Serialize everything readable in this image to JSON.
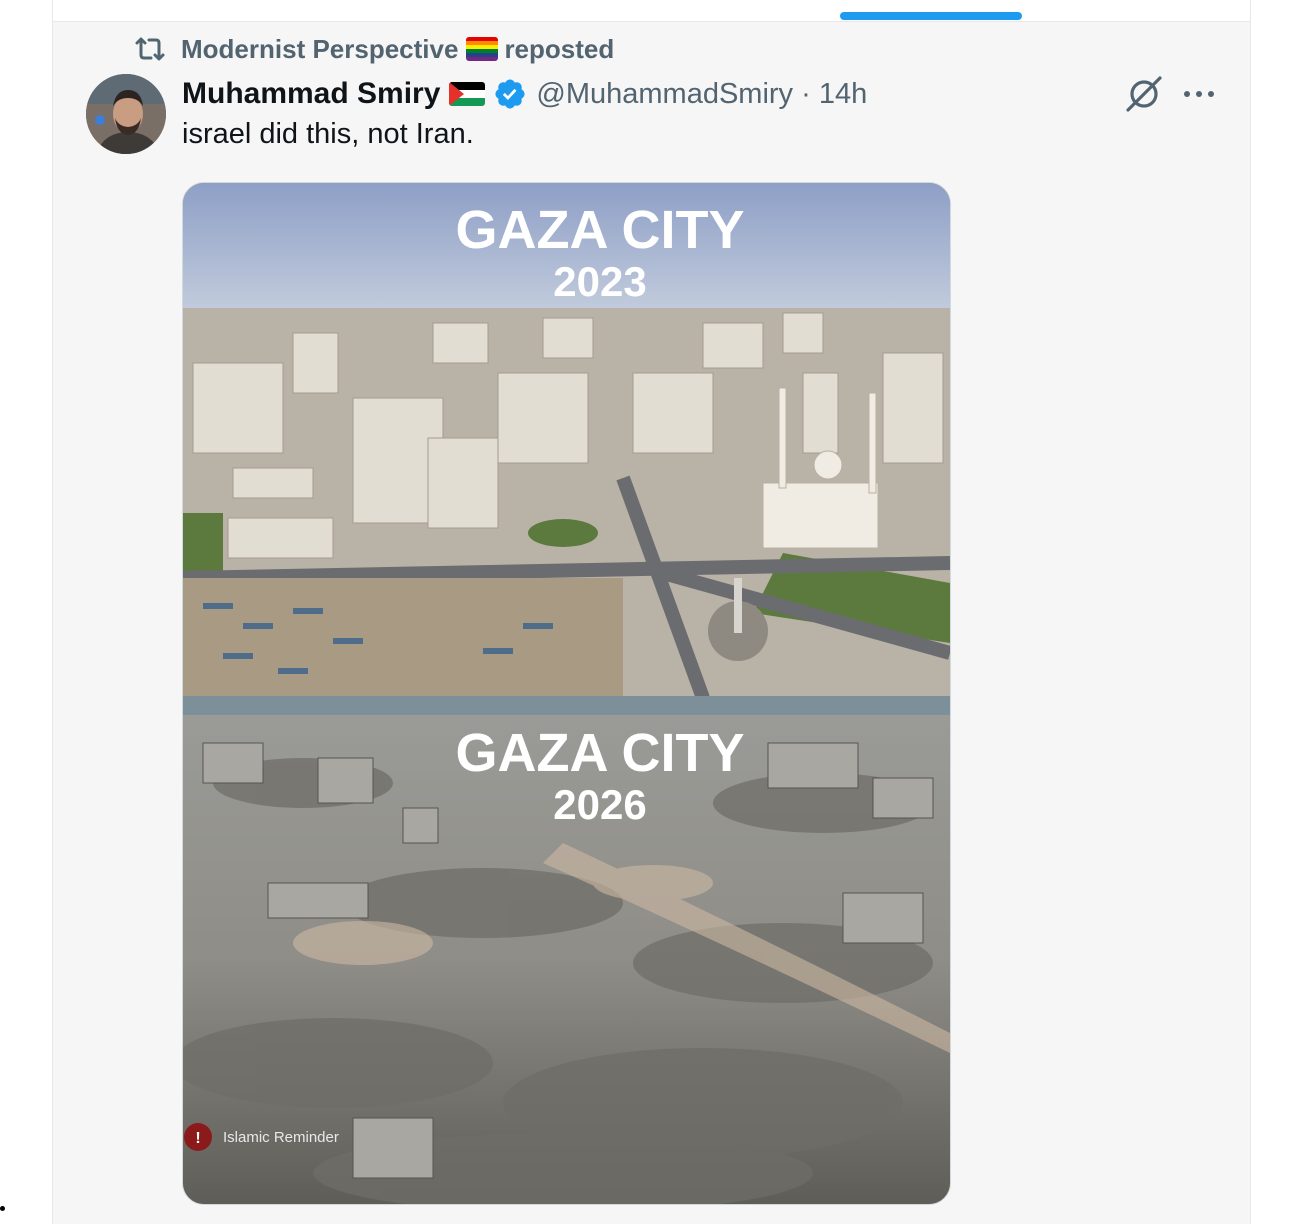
{
  "tabs": {
    "active_indicator_color": "#1d9bf0"
  },
  "repost": {
    "by": "Modernist Perspective",
    "label": "reposted",
    "icon": "repost-icon",
    "emoji": "rainbow-flag"
  },
  "tweet": {
    "author_name": "Muhammad Smiry",
    "author_flag": "palestine-flag",
    "verified": true,
    "verified_color": "#1d9bf0",
    "handle_time": "@MuhammadSmiry · 14h",
    "text": "israel did this, not Iran.",
    "actions": {
      "grok_icon": "grok-icon",
      "more_icon": "more-horizontal-icon"
    },
    "media": {
      "top_title": "GAZA CITY",
      "top_year": "2023",
      "bottom_title": "GAZA CITY",
      "bottom_year": "2026",
      "watermark": "Islamic Reminder"
    }
  },
  "colors": {
    "text_primary": "#0f1419",
    "text_secondary": "#536471",
    "background": "#f6f6f6"
  }
}
